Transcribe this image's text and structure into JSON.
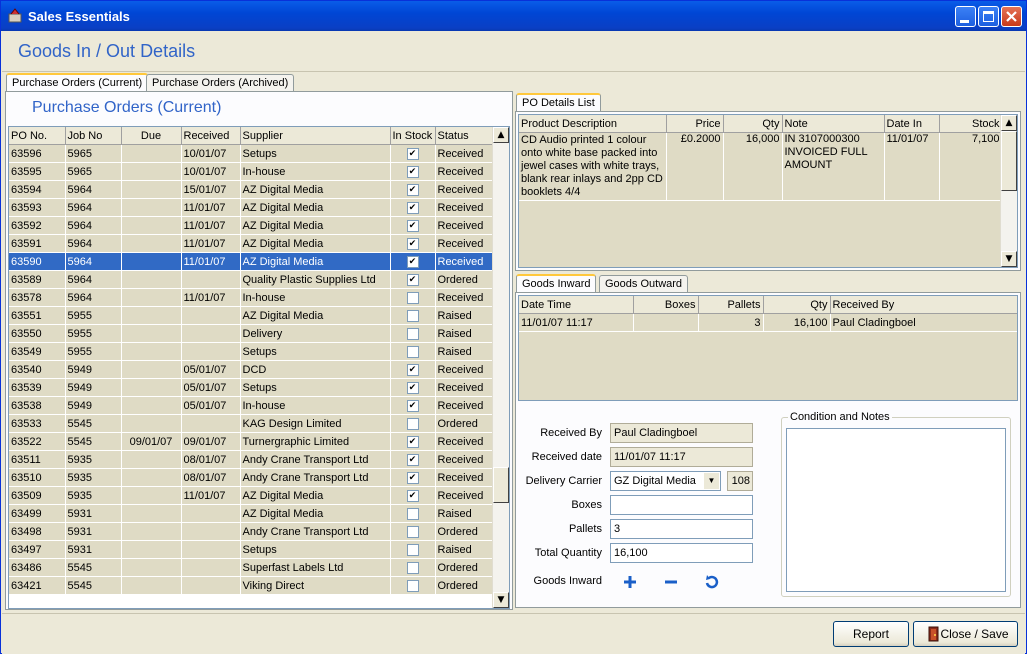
{
  "window": {
    "title": "Sales Essentials"
  },
  "header": {
    "title": "Goods In / Out Details"
  },
  "main_tabs": [
    "Purchase Orders (Current)",
    "Purchase Orders (Archived)"
  ],
  "left_panel": {
    "title": "Purchase Orders (Current)",
    "columns": [
      "PO No.",
      "Job No",
      "Due",
      "Received",
      "Supplier",
      "In Stock",
      "Status"
    ],
    "rows": [
      [
        "63596",
        "5965",
        "",
        "10/01/07",
        "Setups",
        "✔",
        "Received"
      ],
      [
        "63595",
        "5965",
        "",
        "10/01/07",
        "In-house",
        "✔",
        "Received"
      ],
      [
        "63594",
        "5964",
        "",
        "15/01/07",
        "AZ Digital Media",
        "✔",
        "Received"
      ],
      [
        "63593",
        "5964",
        "",
        "11/01/07",
        "AZ Digital Media",
        "✔",
        "Received"
      ],
      [
        "63592",
        "5964",
        "",
        "11/01/07",
        "AZ Digital Media",
        "✔",
        "Received"
      ],
      [
        "63591",
        "5964",
        "",
        "11/01/07",
        "AZ Digital Media",
        "✔",
        "Received"
      ],
      [
        "63590",
        "5964",
        "",
        "11/01/07",
        "AZ Digital Media",
        "✔",
        "Received"
      ],
      [
        "63589",
        "5964",
        "",
        "",
        "Quality Plastic Supplies Ltd",
        "✔",
        "Ordered"
      ],
      [
        "63578",
        "5964",
        "",
        "11/01/07",
        "In-house",
        "",
        "Received"
      ],
      [
        "63551",
        "5955",
        "",
        "",
        "AZ Digital Media",
        "",
        "Raised"
      ],
      [
        "63550",
        "5955",
        "",
        "",
        "Delivery",
        "",
        "Raised"
      ],
      [
        "63549",
        "5955",
        "",
        "",
        "Setups",
        "",
        "Raised"
      ],
      [
        "63540",
        "5949",
        "",
        "05/01/07",
        "DCD",
        "✔",
        "Received"
      ],
      [
        "63539",
        "5949",
        "",
        "05/01/07",
        "Setups",
        "✔",
        "Received"
      ],
      [
        "63538",
        "5949",
        "",
        "05/01/07",
        "In-house",
        "✔",
        "Received"
      ],
      [
        "63533",
        "5545",
        "",
        "",
        "KAG Design Limited",
        "",
        "Ordered"
      ],
      [
        "63522",
        "5545",
        "09/01/07",
        "09/01/07",
        "Turnergraphic Limited",
        "✔",
        "Received"
      ],
      [
        "63511",
        "5935",
        "",
        "08/01/07",
        "Andy Crane Transport Ltd",
        "✔",
        "Received"
      ],
      [
        "63510",
        "5935",
        "",
        "08/01/07",
        "Andy Crane Transport Ltd",
        "✔",
        "Received"
      ],
      [
        "63509",
        "5935",
        "",
        "11/01/07",
        "AZ Digital Media",
        "✔",
        "Received"
      ],
      [
        "63499",
        "5931",
        "",
        "",
        "AZ Digital Media",
        "",
        "Raised"
      ],
      [
        "63498",
        "5931",
        "",
        "",
        "Andy Crane Transport Ltd",
        "",
        "Ordered"
      ],
      [
        "63497",
        "5931",
        "",
        "",
        "Setups",
        "",
        "Raised"
      ],
      [
        "63486",
        "5545",
        "",
        "",
        "Superfast Labels Ltd",
        "",
        "Ordered"
      ],
      [
        "63421",
        "5545",
        "",
        "",
        "Viking Direct",
        "",
        "Ordered"
      ]
    ],
    "selected_index": 6
  },
  "po_details": {
    "tab": "PO Details List",
    "columns": [
      "Product Description",
      "Price",
      "Qty",
      "Note",
      "Date In",
      "Stock"
    ],
    "row": [
      "CD Audio printed 1 colour onto white base packed into jewel cases with white trays, blank rear inlays and 2pp CD booklets 4/4",
      "£0.2000",
      "16,000",
      "IN 3107000300 INVOICED FULL AMOUNT",
      "11/01/07",
      "7,100"
    ]
  },
  "goods_tabs": [
    "Goods Inward",
    "Goods Outward"
  ],
  "goods_inward": {
    "columns": [
      "Date Time",
      "Boxes",
      "Pallets",
      "Qty",
      "Received By"
    ],
    "row": [
      "11/01/07 11:17",
      "",
      "3",
      "16,100",
      "Paul Cladingboel"
    ]
  },
  "form": {
    "received_by_label": "Received By",
    "received_by": "Paul Cladingboel",
    "received_date_label": "Received date",
    "received_date": "11/01/07 11:17",
    "carrier_label": "Delivery Carrier",
    "carrier": "GZ Digital Media",
    "carrier_code": "108",
    "boxes_label": "Boxes",
    "boxes": "",
    "pallets_label": "Pallets",
    "pallets": "3",
    "total_label": "Total Quantity",
    "total": "16,100",
    "goods_inward_label": "Goods Inward",
    "notes_label": "Condition and Notes"
  },
  "footer": {
    "report": "Report",
    "close_save": "Close / Save"
  }
}
